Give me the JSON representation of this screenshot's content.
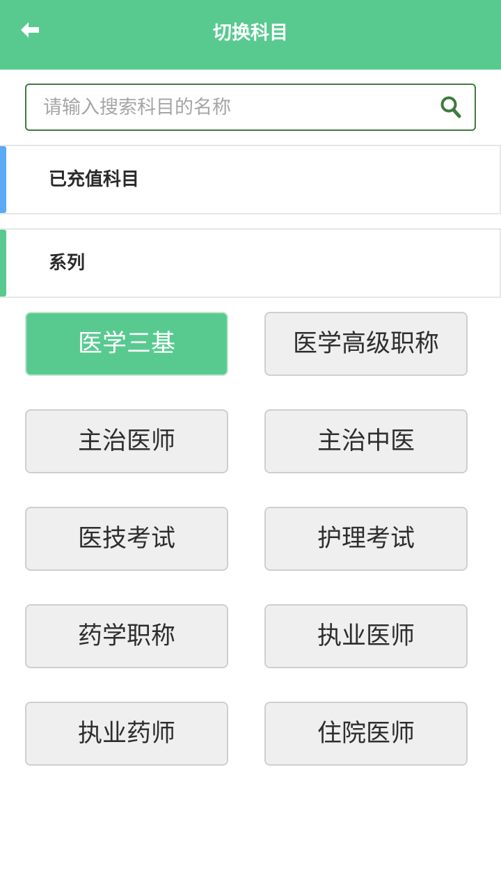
{
  "header": {
    "title": "切换科目",
    "back_icon": "arrow-left-icon",
    "background_color": "#58ca90"
  },
  "search": {
    "placeholder": "请输入搜索科目的名称",
    "value": "",
    "icon": "search-icon",
    "border_color": "#3e7a3e"
  },
  "sections": {
    "recharged": {
      "label": "已充值科目",
      "accent_color": "#5aaaf6"
    },
    "series": {
      "label": "系列",
      "accent_color": "#58ca90"
    }
  },
  "series_items": [
    {
      "label": "医学三基",
      "selected": true
    },
    {
      "label": "医学高级职称",
      "selected": false
    },
    {
      "label": "主治医师",
      "selected": false
    },
    {
      "label": "主治中医",
      "selected": false
    },
    {
      "label": "医技考试",
      "selected": false
    },
    {
      "label": "护理考试",
      "selected": false
    },
    {
      "label": "药学职称",
      "selected": false
    },
    {
      "label": "执业医师",
      "selected": false
    },
    {
      "label": "执业药师",
      "selected": false
    },
    {
      "label": "住院医师",
      "selected": false
    }
  ]
}
